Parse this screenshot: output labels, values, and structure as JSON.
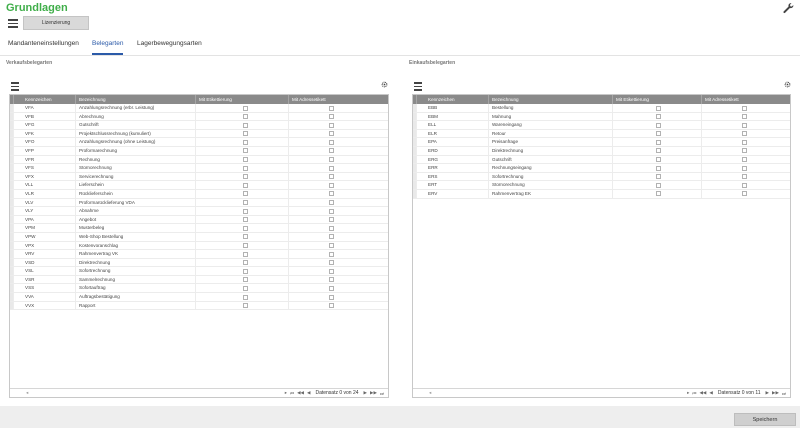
{
  "page": {
    "title": "Grundlagen"
  },
  "header": {
    "license_button": "Lizenzierung"
  },
  "tabs": [
    {
      "label": "Mandanteneinstellungen",
      "active": false
    },
    {
      "label": "Belegarten",
      "active": true
    },
    {
      "label": "Lagerbewegungsarten",
      "active": false
    }
  ],
  "verkauf": {
    "title": "Verkaufsbelegarten",
    "columns": [
      "Kennzeichen",
      "Bezeichnung",
      "Mit Etikettierung",
      "Mit Adressetikett"
    ],
    "rows": [
      {
        "code": "VFA",
        "name": "Anzahlungsrechnung (erbr. Leistung)"
      },
      {
        "code": "VFB",
        "name": "Abrechnung"
      },
      {
        "code": "VFG",
        "name": "Gutschrift"
      },
      {
        "code": "VFK",
        "name": "Projektschlussrechnung (kumuliert)"
      },
      {
        "code": "VFO",
        "name": "Anzahlungsrechnung (ohne Leistung)"
      },
      {
        "code": "VFP",
        "name": "Proformarechnung"
      },
      {
        "code": "VFR",
        "name": "Rechnung"
      },
      {
        "code": "VFS",
        "name": "Stornorechnung"
      },
      {
        "code": "VFX",
        "name": "Servicerechnung"
      },
      {
        "code": "VLL",
        "name": "Lieferschein"
      },
      {
        "code": "VLR",
        "name": "Rücklieferschein"
      },
      {
        "code": "VLV",
        "name": "Proformarücklieferung VDA"
      },
      {
        "code": "VLY",
        "name": "Abnahme"
      },
      {
        "code": "VPA",
        "name": "Angebot"
      },
      {
        "code": "VPM",
        "name": "Musterbeleg"
      },
      {
        "code": "VPW",
        "name": "Web-Shop Bestellung"
      },
      {
        "code": "VPX",
        "name": "Kostenvoranschlag"
      },
      {
        "code": "VRV",
        "name": "Rahmenvertrag VK"
      },
      {
        "code": "VSD",
        "name": "Direktrechnung"
      },
      {
        "code": "VSL",
        "name": "Sofortrechnung"
      },
      {
        "code": "VSR",
        "name": "Sammelrechnung"
      },
      {
        "code": "VSS",
        "name": "Sofortauftrag"
      },
      {
        "code": "VVA",
        "name": "Auftragsbestätigung"
      },
      {
        "code": "VVX",
        "name": "Rapport"
      }
    ],
    "footer": "Datensatz 0 von 24"
  },
  "einkauf": {
    "title": "Einkaufsbelegarten",
    "columns": [
      "Kennzeichen",
      "Bezeichnung",
      "Mit Etikettierung",
      "Mit Adressetikett"
    ],
    "rows": [
      {
        "code": "EBB",
        "name": "Bestellung"
      },
      {
        "code": "EBM",
        "name": "Mahnung"
      },
      {
        "code": "ELL",
        "name": "Wareneingang"
      },
      {
        "code": "ELR",
        "name": "Retour"
      },
      {
        "code": "EPA",
        "name": "Preisanfrage"
      },
      {
        "code": "ERD",
        "name": "Direktrechnung"
      },
      {
        "code": "ERG",
        "name": "Gutschrift"
      },
      {
        "code": "ERR",
        "name": "Rechnungseingang"
      },
      {
        "code": "ERS",
        "name": "Sofortrechnung"
      },
      {
        "code": "ERT",
        "name": "Stornorechnung"
      },
      {
        "code": "ERV",
        "name": "Rahmenvertrag EK"
      }
    ],
    "footer": "Datensatz 0 von 11"
  },
  "footer_bar": {
    "save_button": "Speichern"
  },
  "icons": [
    "wrench-icon",
    "menu-icon",
    "grid-menu-icon",
    "gear-icon",
    "first-page-icon",
    "prev-page-icon",
    "prev-icon",
    "next-icon",
    "next-page-icon",
    "last-page-icon"
  ],
  "colors": {
    "title_green": "#3fae49",
    "tab_active": "#2b5aa8",
    "grid_header": "#8a8a8a"
  }
}
